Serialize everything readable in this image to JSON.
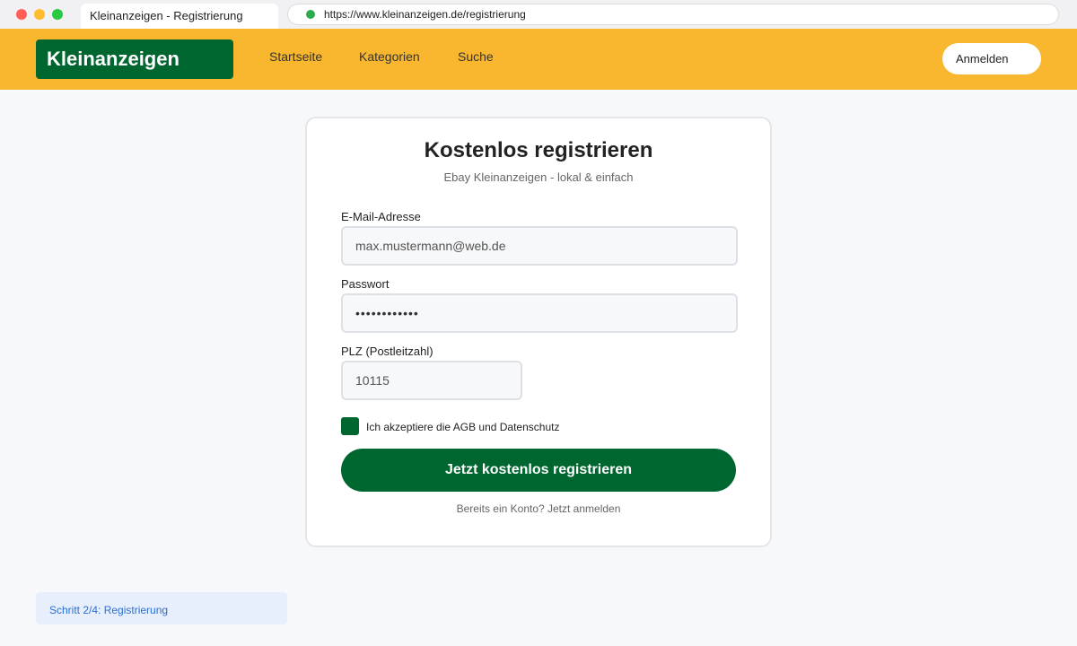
{
  "colors": {
    "brand_green": "#00662f",
    "header_yellow": "#f8b72e",
    "step_blue": "#2a6fd1",
    "dot_red": "#ff5f57",
    "dot_yellow": "#febc2e",
    "dot_green": "#28c840",
    "secure_green": "#2eaa4f"
  },
  "browser": {
    "tab_title": "Kleinanzeigen - Registrierung",
    "url": "https://www.kleinanzeigen.de/registrierung",
    "icons": {
      "secure": "secure-dot-icon"
    }
  },
  "header": {
    "logo": "Kleinanzeigen",
    "nav": [
      "Startseite",
      "Kategorien",
      "Suche"
    ],
    "login_label": "Anmelden"
  },
  "form": {
    "title": "Kostenlos registrieren",
    "subtitle": "Ebay Kleinanzeigen - lokal & einfach",
    "email_label": "E-Mail-Adresse",
    "email_value": "max.mustermann@web.de",
    "password_label": "Passwort",
    "password_value": "••••••••••••",
    "plz_label": "PLZ (Postleitzahl)",
    "plz_value": "10115",
    "terms_label": "Ich akzeptiere die AGB und Datenschutz",
    "terms_checked": true,
    "submit_label": "Jetzt kostenlos registrieren",
    "login_link": "Bereits ein Konto? Jetzt anmelden"
  },
  "step": {
    "label": "Schritt 2/4: Registrierung"
  }
}
